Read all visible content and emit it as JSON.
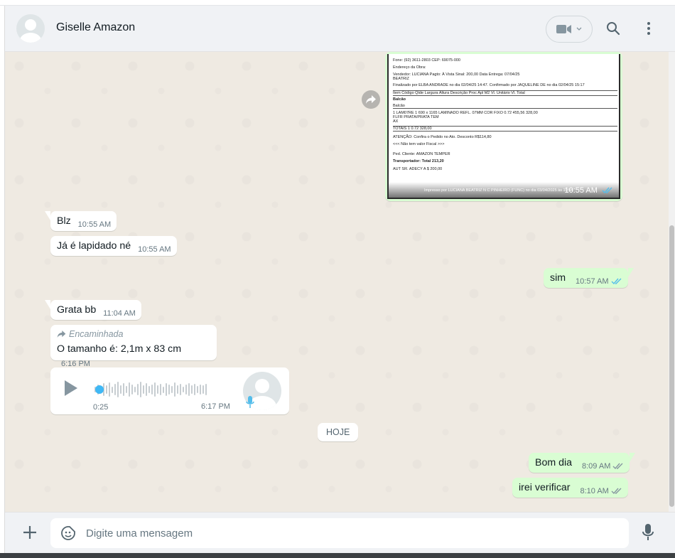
{
  "header": {
    "contact_name": "Giselle Amazon"
  },
  "image_message": {
    "doc_lines": [
      "Fone: (92) 3611-2803                                CEP: 69075-000",
      "Endereço da Obra:",
      "Vendedor: LUCIANA          Pagto:  À Vista                  Sinal:  200,00        Data Entrega: 07/04/25",
      "               BEATRIZ",
      "Finalizado por ELBA ANDRADE no dia 02/04/25 14:47. Confirmado por JAQUELINE DE no dia 02/04/25 15:17",
      "Item  Código     Qtde   Largura     Altura  Descrição                        Proc   Apl   M2     Vl. Unitário   Vl. Total",
      "                                                          Balcão",
      "                                                          Balcão",
      "  1   LAM07RE     1      690   x   1165  LAMINADO REFL. 07MM     COR   FIXO  0.72    455,56        328,00",
      "       FLFR                                      PRATA/PRATA             TEM",
      "                                                                                      AX",
      "       TOTAIS    1                                                                          0.72                          328,00",
      "                                            ATENÇÃO: Confira o Pedido no Ato.          Desconto   R$114,80",
      "                                             <<< Não tem valor Fiscal >>>",
      "Ped. Cliente:   AMAZON TEMPER",
      "Transportador:                                                                         Total       213,20",
      "AUT SR. ADECY A $ 200,00",
      "Impresso por LUCIANA BEATRIZ N C PINHEIRO  (FUNC) no dia 03/04/2025 às 10:54"
    ],
    "time": "10:55 AM"
  },
  "messages": [
    {
      "text": "Blz",
      "time": "10:55 AM"
    },
    {
      "text": "Já é lapidado né",
      "time": "10:55 AM"
    },
    {
      "text": "sim",
      "time": "10:57 AM"
    },
    {
      "text": "Grata bb",
      "time": "11:04 AM"
    },
    {
      "forwarded_label": "Encaminhada",
      "text": "O tamanho é: 2,1m x 83 cm",
      "time": "6:16 PM"
    }
  ],
  "audio": {
    "duration": "0:25",
    "time": "6:17 PM",
    "progress": 0
  },
  "day_separator": "HOJE",
  "today_messages": [
    {
      "text": "Bom dia",
      "time": "8:09 AM"
    },
    {
      "text": "irei verificar",
      "time": "8:10 AM"
    }
  ],
  "composer": {
    "placeholder": "Digite uma mensagem"
  },
  "colors": {
    "outgoing": "#d9fdd3",
    "incoming": "#ffffff",
    "read_check": "#53bdeb",
    "wallpaper": "#efeae2"
  }
}
